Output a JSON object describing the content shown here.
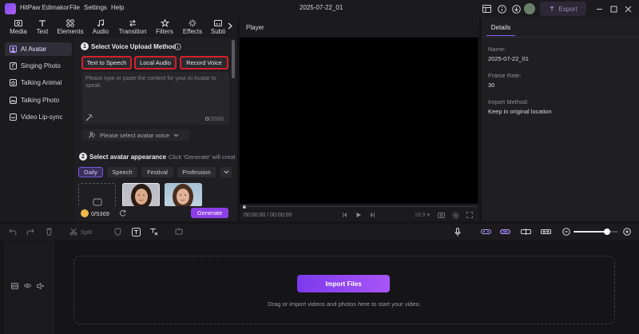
{
  "titlebar": {
    "app_name": "HitPaw Edimakor",
    "menus": [
      "File",
      "Settings",
      "Help"
    ],
    "project_name": "2025-07-22_01",
    "export_label": "Export"
  },
  "toolbar": {
    "tools": [
      "Media",
      "Text",
      "Elements",
      "Audio",
      "Transition",
      "Filters",
      "Effects",
      "Subti"
    ]
  },
  "sidebar": {
    "items": [
      {
        "label": "AI Avatar",
        "icon": "ai-avatar-icon",
        "active": true
      },
      {
        "label": "Singing Photo",
        "icon": "singing-photo-icon",
        "active": false
      },
      {
        "label": "Talking Animal",
        "icon": "talking-animal-icon",
        "active": false
      },
      {
        "label": "Talking Photo",
        "icon": "talking-photo-icon",
        "active": false
      },
      {
        "label": "Video Lip-sync",
        "icon": "lip-sync-icon",
        "active": false
      }
    ]
  },
  "voice_section": {
    "step": "1",
    "title": "Select Voice Upload Method",
    "methods": [
      "Text to Speech",
      "Local Audio",
      "Record Voice"
    ],
    "placeholder": "Please type or paste the content for your AI Avatar to speak.",
    "char_count": "0",
    "char_limit": "/2000",
    "voice_select": "Please select avatar voice"
  },
  "appearance_section": {
    "step": "2",
    "title": "Select avatar appearance",
    "hint": "Click 'Generate' will creat",
    "tabs": [
      "Daily",
      "Speech",
      "Festival",
      "Profession"
    ],
    "active_tab": "Daily"
  },
  "credits": {
    "used": "0",
    "total": "/5369",
    "generate_label": "Generate"
  },
  "player": {
    "title": "Player",
    "time_current": "00:00:00",
    "time_total": "/ 00:00:00",
    "aspect": "16:9",
    "progress": 0
  },
  "details": {
    "tab": "Details",
    "name_label": "Name:",
    "name_value": "2025-07-22_01",
    "frame_rate_label": "Frame Rate:",
    "frame_rate_value": "30",
    "import_method_label": "Import Method:",
    "import_method_value": "Keep in original location"
  },
  "timeline": {
    "split_label": "Split",
    "zoom_level": 0.75,
    "import_label": "Import Files",
    "drop_hint": "Drag or import videos and photos here to start your video."
  },
  "colors": {
    "accent": "#8c3fe6",
    "highlight_border": "#d4202a",
    "background": "#151517"
  }
}
